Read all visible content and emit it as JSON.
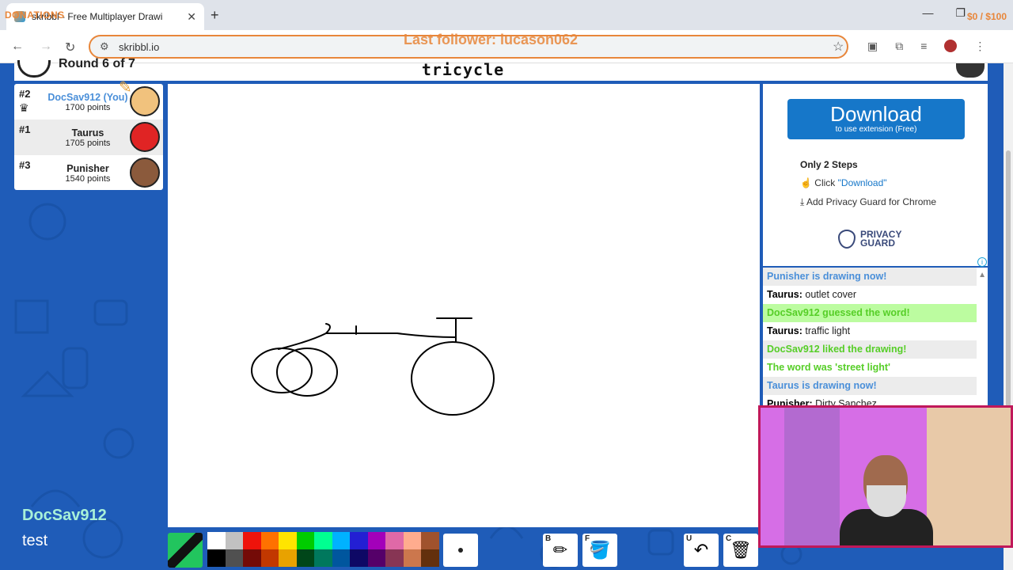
{
  "browser": {
    "tab_title": "skribbl - Free Multiplayer Drawi",
    "url": "skribbl.io",
    "overlay_donations": "DONATIONS",
    "overlay_money": "$0 / $100",
    "overlay_follower": "Last follower: lucason062"
  },
  "game": {
    "round_text": "Round 6 of 7",
    "word": "tricycle",
    "players": [
      {
        "rank": "#2",
        "name": "DocSav912 (You)",
        "points": "1700 points",
        "color": "#f1c27d"
      },
      {
        "rank": "#1",
        "name": "Taurus",
        "points": "1705 points",
        "color": "#e02424"
      },
      {
        "rank": "#3",
        "name": "Punisher",
        "points": "1540 points",
        "color": "#8b5a3c"
      }
    ],
    "palette": [
      "#ffffff",
      "#c1c1c1",
      "#ef130b",
      "#ff7100",
      "#ffe400",
      "#00cc00",
      "#00ff91",
      "#00b2ff",
      "#231fd3",
      "#a300ba",
      "#df69a7",
      "#ffac8e",
      "#a0522d",
      "#000000",
      "#505050",
      "#740b07",
      "#c23800",
      "#e8a200",
      "#004619",
      "#00785d",
      "#00569e",
      "#0e0865",
      "#550069",
      "#873554",
      "#cc774d",
      "#63300d"
    ],
    "tool_keys": {
      "brush": "B",
      "fill": "F",
      "undo": "U",
      "clear": "C"
    }
  },
  "ad": {
    "download_label": "Download",
    "download_sub": "to use extension (Free)",
    "steps_title": "Only 2 Steps",
    "step1_prefix": "Click ",
    "step1_link": "\"Download\"",
    "step2": "Add Privacy Guard for Chrome",
    "brand_line1": "PRIVACY",
    "brand_line2": "GUARD"
  },
  "chat": [
    {
      "who": "",
      "text": "Punisher is drawing now!",
      "color": "#4a8fd9",
      "bg": "#ececec",
      "bold": true
    },
    {
      "who": "Taurus:",
      "text": " outlet cover",
      "color": "#222",
      "bg": "#ffffff",
      "bold": false
    },
    {
      "who": "",
      "text": "DocSav912 guessed the word!",
      "color": "#56ce27",
      "bg": "#bcfca0",
      "bold": true
    },
    {
      "who": "Taurus:",
      "text": " traffic light",
      "color": "#222",
      "bg": "#ffffff",
      "bold": false
    },
    {
      "who": "",
      "text": "DocSav912 liked the drawing!",
      "color": "#56ce27",
      "bg": "#ececec",
      "bold": true
    },
    {
      "who": "",
      "text": "The word was 'street light'",
      "color": "#56ce27",
      "bg": "#ffffff",
      "bold": true
    },
    {
      "who": "",
      "text": "Taurus is drawing now!",
      "color": "#4a8fd9",
      "bg": "#ececec",
      "bold": true
    },
    {
      "who": "Punisher:",
      "text": " Dirty Sanchez",
      "color": "#222",
      "bg": "#ffffff",
      "bold": false
    }
  ],
  "stream": {
    "name": "DocSav912",
    "message": "test"
  }
}
